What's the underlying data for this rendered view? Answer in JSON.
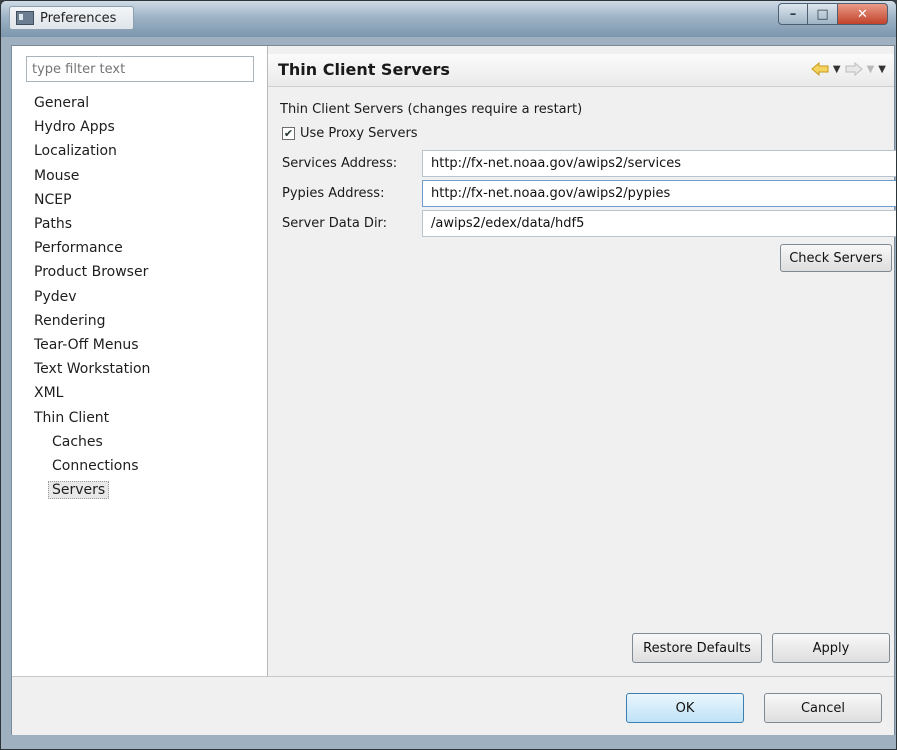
{
  "window": {
    "title": "Preferences",
    "controls": {
      "minimize": "–",
      "maximize": "□",
      "close": "✕"
    }
  },
  "sidebar": {
    "filter_placeholder": "type filter text",
    "items": [
      {
        "label": "General",
        "level": 0
      },
      {
        "label": "Hydro Apps",
        "level": 0
      },
      {
        "label": "Localization",
        "level": 0
      },
      {
        "label": "Mouse",
        "level": 0
      },
      {
        "label": "NCEP",
        "level": 0
      },
      {
        "label": "Paths",
        "level": 0
      },
      {
        "label": "Performance",
        "level": 0
      },
      {
        "label": "Product Browser",
        "level": 0
      },
      {
        "label": "Pydev",
        "level": 0
      },
      {
        "label": "Rendering",
        "level": 0
      },
      {
        "label": "Tear-Off Menus",
        "level": 0
      },
      {
        "label": "Text Workstation",
        "level": 0
      },
      {
        "label": "XML",
        "level": 0
      },
      {
        "label": "Thin Client",
        "level": 0
      },
      {
        "label": "Caches",
        "level": 1
      },
      {
        "label": "Connections",
        "level": 1
      },
      {
        "label": "Servers",
        "level": 1,
        "selected": true
      }
    ]
  },
  "page": {
    "title": "Thin Client Servers",
    "description": "Thin Client Servers (changes require a restart)",
    "use_proxy": {
      "label": "Use Proxy Servers",
      "checked": true
    },
    "fields": {
      "services": {
        "label": "Services Address:",
        "value": "http://fx-net.noaa.gov/awips2/services"
      },
      "pypies": {
        "label": "Pypies Address:",
        "value": "http://fx-net.noaa.gov/awips2/pypies"
      },
      "data_dir": {
        "label": "Server Data Dir:",
        "value": "/awips2/edex/data/hdf5"
      }
    },
    "check_servers_label": "Check Servers",
    "restore_defaults_label": "Restore Defaults",
    "apply_label": "Apply"
  },
  "footer": {
    "ok_label": "OK",
    "cancel_label": "Cancel"
  },
  "colors": {
    "accent": "#3c7fb1",
    "back_arrow": "#e8b923"
  }
}
